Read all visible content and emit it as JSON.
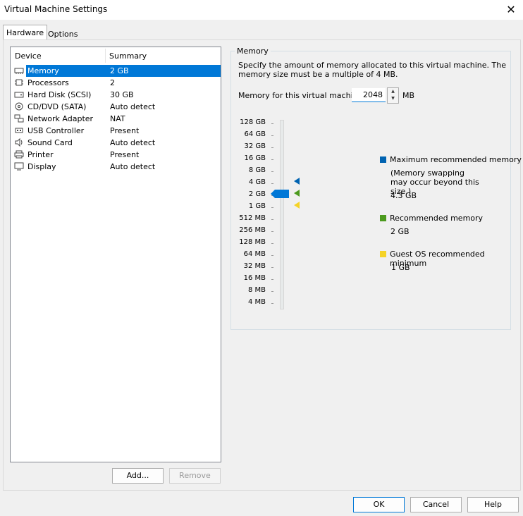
{
  "window": {
    "title": "Virtual Machine Settings",
    "close_glyph": "✕"
  },
  "tabs": [
    {
      "label": "Hardware",
      "active": true
    },
    {
      "label": "Options",
      "active": false
    }
  ],
  "device_list": {
    "headers": {
      "device": "Device",
      "summary": "Summary"
    },
    "rows": [
      {
        "name": "Memory",
        "summary": "2 GB",
        "icon": "memory-icon",
        "selected": true
      },
      {
        "name": "Processors",
        "summary": "2",
        "icon": "processor-icon"
      },
      {
        "name": "Hard Disk (SCSI)",
        "summary": "30 GB",
        "icon": "hard-disk-icon"
      },
      {
        "name": "CD/DVD (SATA)",
        "summary": "Auto detect",
        "icon": "cd-dvd-icon"
      },
      {
        "name": "Network Adapter",
        "summary": "NAT",
        "icon": "network-adapter-icon"
      },
      {
        "name": "USB Controller",
        "summary": "Present",
        "icon": "usb-icon"
      },
      {
        "name": "Sound Card",
        "summary": "Auto detect",
        "icon": "sound-card-icon"
      },
      {
        "name": "Printer",
        "summary": "Present",
        "icon": "printer-icon"
      },
      {
        "name": "Display",
        "summary": "Auto detect",
        "icon": "display-icon"
      }
    ]
  },
  "list_buttons": {
    "add": "Add...",
    "remove": "Remove"
  },
  "memory": {
    "group_title": "Memory",
    "description": "Specify the amount of memory allocated to this virtual machine. The memory size must be a multiple of 4 MB.",
    "field_label": "Memory for this virtual machine:",
    "value": "2048",
    "unit": "MB",
    "scale": [
      "128 GB",
      "64 GB",
      "32 GB",
      "16 GB",
      "8 GB",
      "4 GB",
      "2 GB",
      "1 GB",
      "512 MB",
      "256 MB",
      "128 MB",
      "64 MB",
      "32 MB",
      "16 MB",
      "8 MB",
      "4 MB"
    ],
    "selected_level": "2 GB",
    "legend": {
      "max": {
        "label": "Maximum recommended memory",
        "note": "(Memory swapping may occur beyond this size.)",
        "value": "4.3 GB",
        "color": "#0063b1"
      },
      "recommended": {
        "label": "Recommended memory",
        "value": "2 GB",
        "color": "#4c9a1e"
      },
      "guest_min": {
        "label": "Guest OS recommended minimum",
        "value": "1 GB",
        "color": "#f5d327"
      }
    }
  },
  "footer": {
    "ok": "OK",
    "cancel": "Cancel",
    "help": "Help"
  }
}
